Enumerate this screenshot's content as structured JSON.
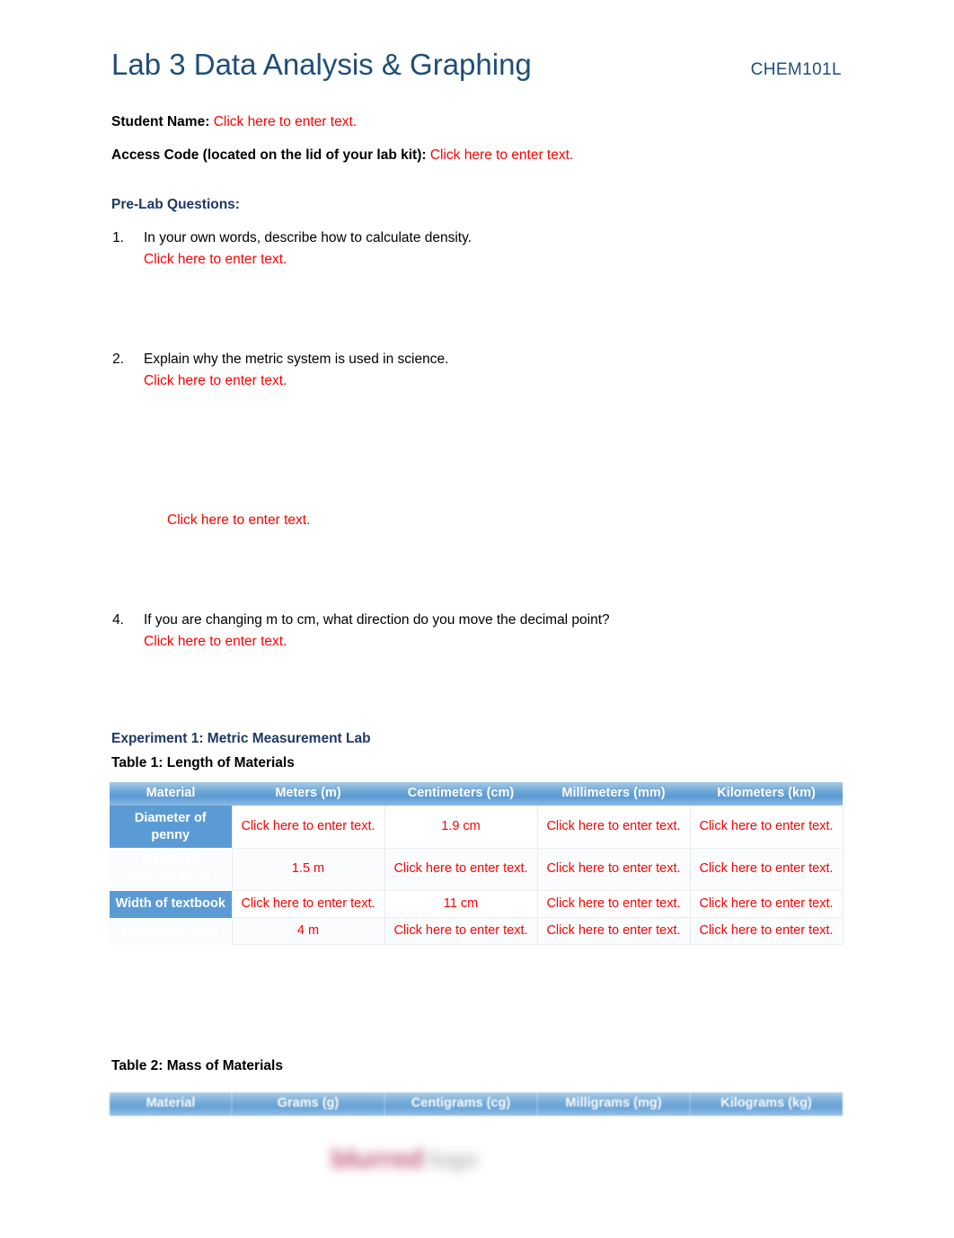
{
  "header": {
    "title": "Lab 3 Data Analysis & Graphing",
    "course_code": "CHEM101L",
    "title_color": "#1F4E79"
  },
  "fields": {
    "student_name_label": "Student Name:",
    "student_name_value": "Click here to enter text.",
    "access_code_label": "Access Code (located on the lid of your lab kit):",
    "access_code_value": "Click here to enter text."
  },
  "prelab": {
    "heading": "Pre-Lab Questions:",
    "questions": [
      {
        "number": "1.",
        "text": "In your own words, describe how to calculate density.",
        "answer": "Click here to enter text."
      },
      {
        "number": "2.",
        "text": "Explain why the metric system is used in science.",
        "answer": "Click here to enter text."
      },
      {
        "number": "4.",
        "text": "If you are changing m to cm, what direction do you move the decimal point?",
        "answer": "Click here to enter text."
      }
    ],
    "orphan_answer": "Click here to enter text."
  },
  "experiment": {
    "heading": "Experiment 1: Metric Measurement Lab"
  },
  "table1": {
    "caption": "Table 1: Length of Materials",
    "headers": [
      "Material",
      "Meters (m)",
      "Centimeters (cm)",
      "Millimeters (mm)",
      "Kilometers (km)"
    ],
    "rows": [
      {
        "material": "Diameter of penny",
        "cells": [
          "Click here to enter text.",
          "1.9 cm",
          "Click here to enter text.",
          "Click here to enter text."
        ]
      },
      {
        "material": "Height of counter/table",
        "cells": [
          "1.5 m",
          "Click here to enter text.",
          "Click here to enter text.",
          "Click here to enter text."
        ]
      },
      {
        "material": "Width of textbook",
        "cells": [
          "Click here to enter text.",
          "11 cm",
          "Click here to enter text.",
          "Click here to enter text."
        ]
      },
      {
        "material": "Length of room",
        "cells": [
          "4 m",
          "Click here to enter text.",
          "Click here to enter text.",
          "Click here to enter text."
        ]
      }
    ]
  },
  "table2": {
    "caption": "Table 2: Mass of Materials",
    "headers": [
      "Material",
      "Grams (g)",
      "Centigrams (cg)",
      "Milligrams (mg)",
      "Kilograms (kg)"
    ]
  },
  "watermark": {
    "main": "blurred",
    "sub": "logo",
    "main_color": "#c4607c",
    "sub_color": "#b9bcbe"
  },
  "colors": {
    "heading_blue": "#1F4E79",
    "subheading_blue": "#1F3864",
    "placeholder_red": "#FF0000",
    "table_accent_blue": "#5B9BD5"
  }
}
